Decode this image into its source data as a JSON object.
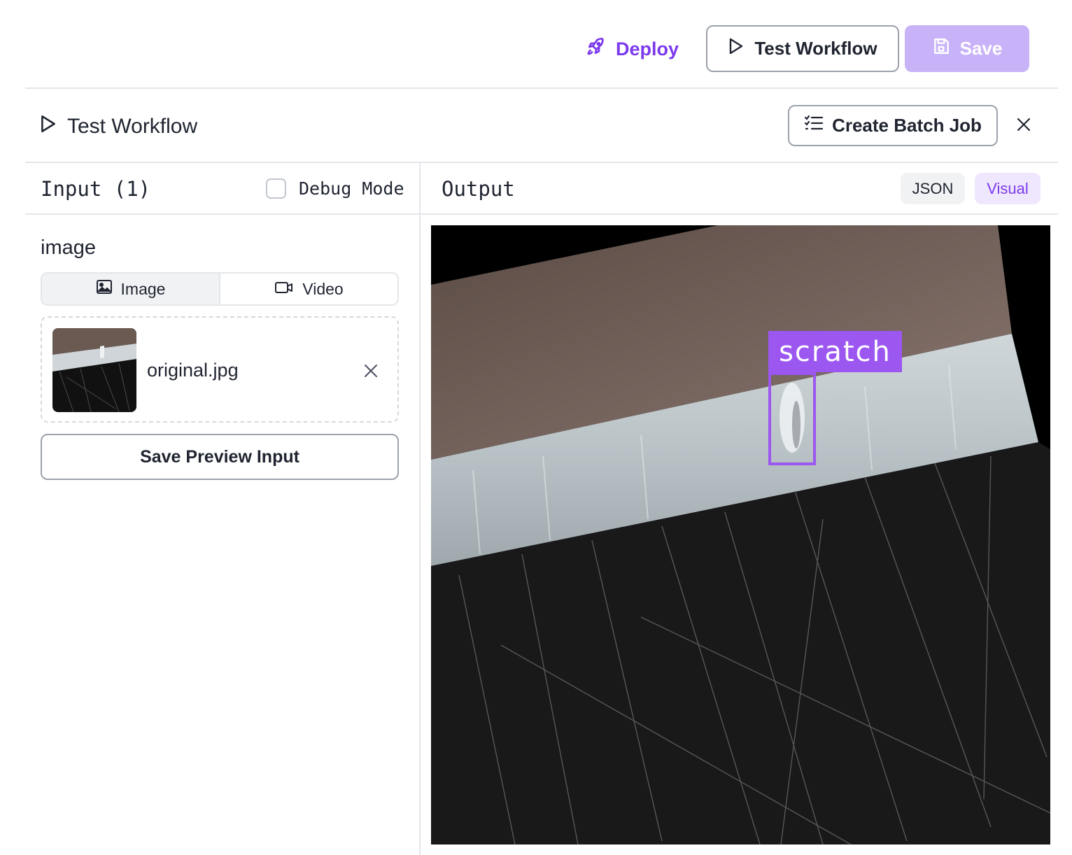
{
  "toolbar": {
    "deploy_label": "Deploy",
    "test_label": "Test Workflow",
    "save_label": "Save"
  },
  "panel": {
    "title": "Test Workflow",
    "batch_label": "Create Batch Job"
  },
  "input": {
    "title": "Input (1)",
    "debug_label": "Debug Mode",
    "debug_checked": false,
    "field_label": "image",
    "tabs": [
      {
        "label": "Image",
        "icon": "image-icon",
        "active": true
      },
      {
        "label": "Video",
        "icon": "video-icon",
        "active": false
      }
    ],
    "file_name": "original.jpg",
    "save_preview_label": "Save Preview Input"
  },
  "output": {
    "title": "Output",
    "modes": [
      {
        "label": "JSON",
        "active": false
      },
      {
        "label": "Visual",
        "active": true
      }
    ],
    "detection_label": "scratch"
  },
  "colors": {
    "accent": "#7c3aed",
    "save_disabled": "#c9b3f8",
    "detection": "#9b57f0"
  }
}
